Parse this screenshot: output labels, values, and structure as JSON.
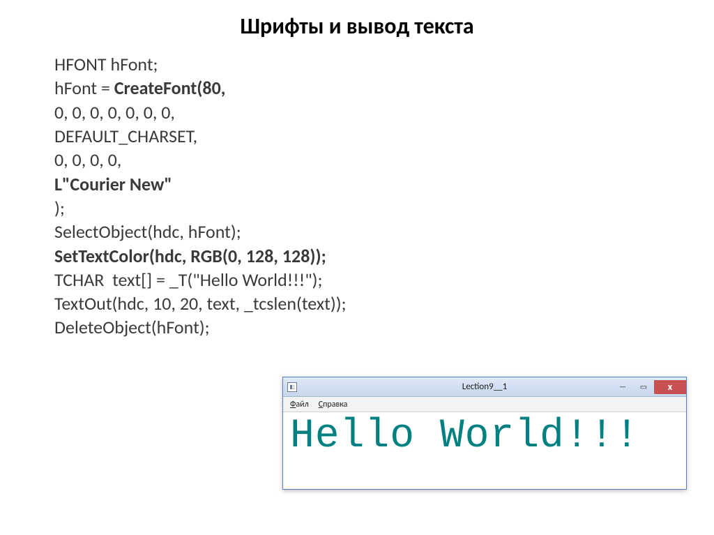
{
  "title": "Шрифты и вывод текста",
  "code": {
    "l1": "HFONT hFont;",
    "l2a": "hFont = ",
    "l2b": "CreateFont(80,",
    "l3": "0, 0, 0, 0, 0, 0, 0,",
    "l4": "DEFAULT_CHARSET,",
    "l5": "0, 0, 0, 0,",
    "l6": "L\"Courier New\"",
    "l7": ");",
    "l8": "SelectObject(hdc, hFont);",
    "l9": "SetTextColor(hdc, RGB(0, 128, 128));",
    "l10": "TCHAR  text[] = _T(\"Hello World!!!\");",
    "l11": "TextOut(hdc, 10, 20, text, _tcslen(text));",
    "l12": "DeleteObject(hFont);"
  },
  "window": {
    "title": "Lection9__1",
    "menu": {
      "file": "Файл",
      "help": "Справка"
    },
    "buttons": {
      "min": "—",
      "max": "▭",
      "close": "x"
    },
    "hello": "Hello World!!!",
    "hello_color": "#008080"
  }
}
